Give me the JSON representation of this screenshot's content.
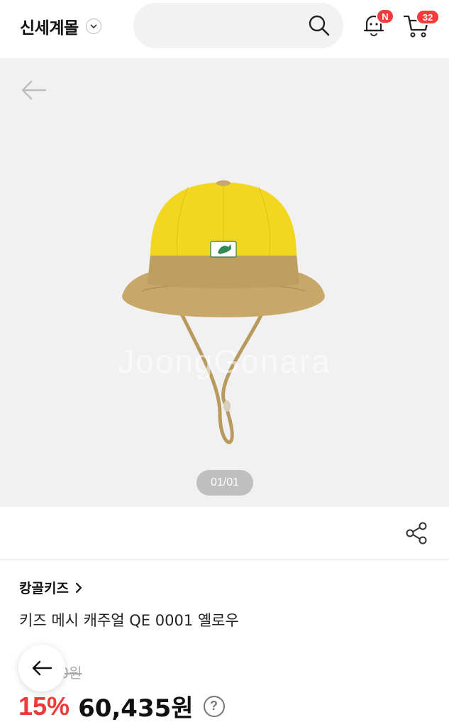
{
  "header": {
    "brand_name": "신세계몰",
    "search_placeholder": "",
    "notification_badge": "N",
    "cart_count": "32"
  },
  "gallery": {
    "watermark": "JoongGonara",
    "counter": "01/01",
    "product_image": "yellow-kids-bucket-hat"
  },
  "product": {
    "brand": "캉골키즈",
    "name": "키즈 메시 캐주얼 QE 0001 옐로우",
    "original_price": "71,100원",
    "discount": "15%",
    "sale_price": "60,435원",
    "help": "?"
  },
  "icons": {
    "brand_chevron": "chevron-down-icon",
    "search": "search-icon",
    "bell": "bell-icon",
    "cart": "cart-icon",
    "back": "arrow-left-icon",
    "share": "share-icon"
  },
  "colors": {
    "accent_red": "#f03a3a",
    "badge_red": "#f23b3b",
    "gallery_bg": "#f1f1f1",
    "hat_yellow": "#f2d422",
    "hat_khaki": "#c4a566"
  }
}
